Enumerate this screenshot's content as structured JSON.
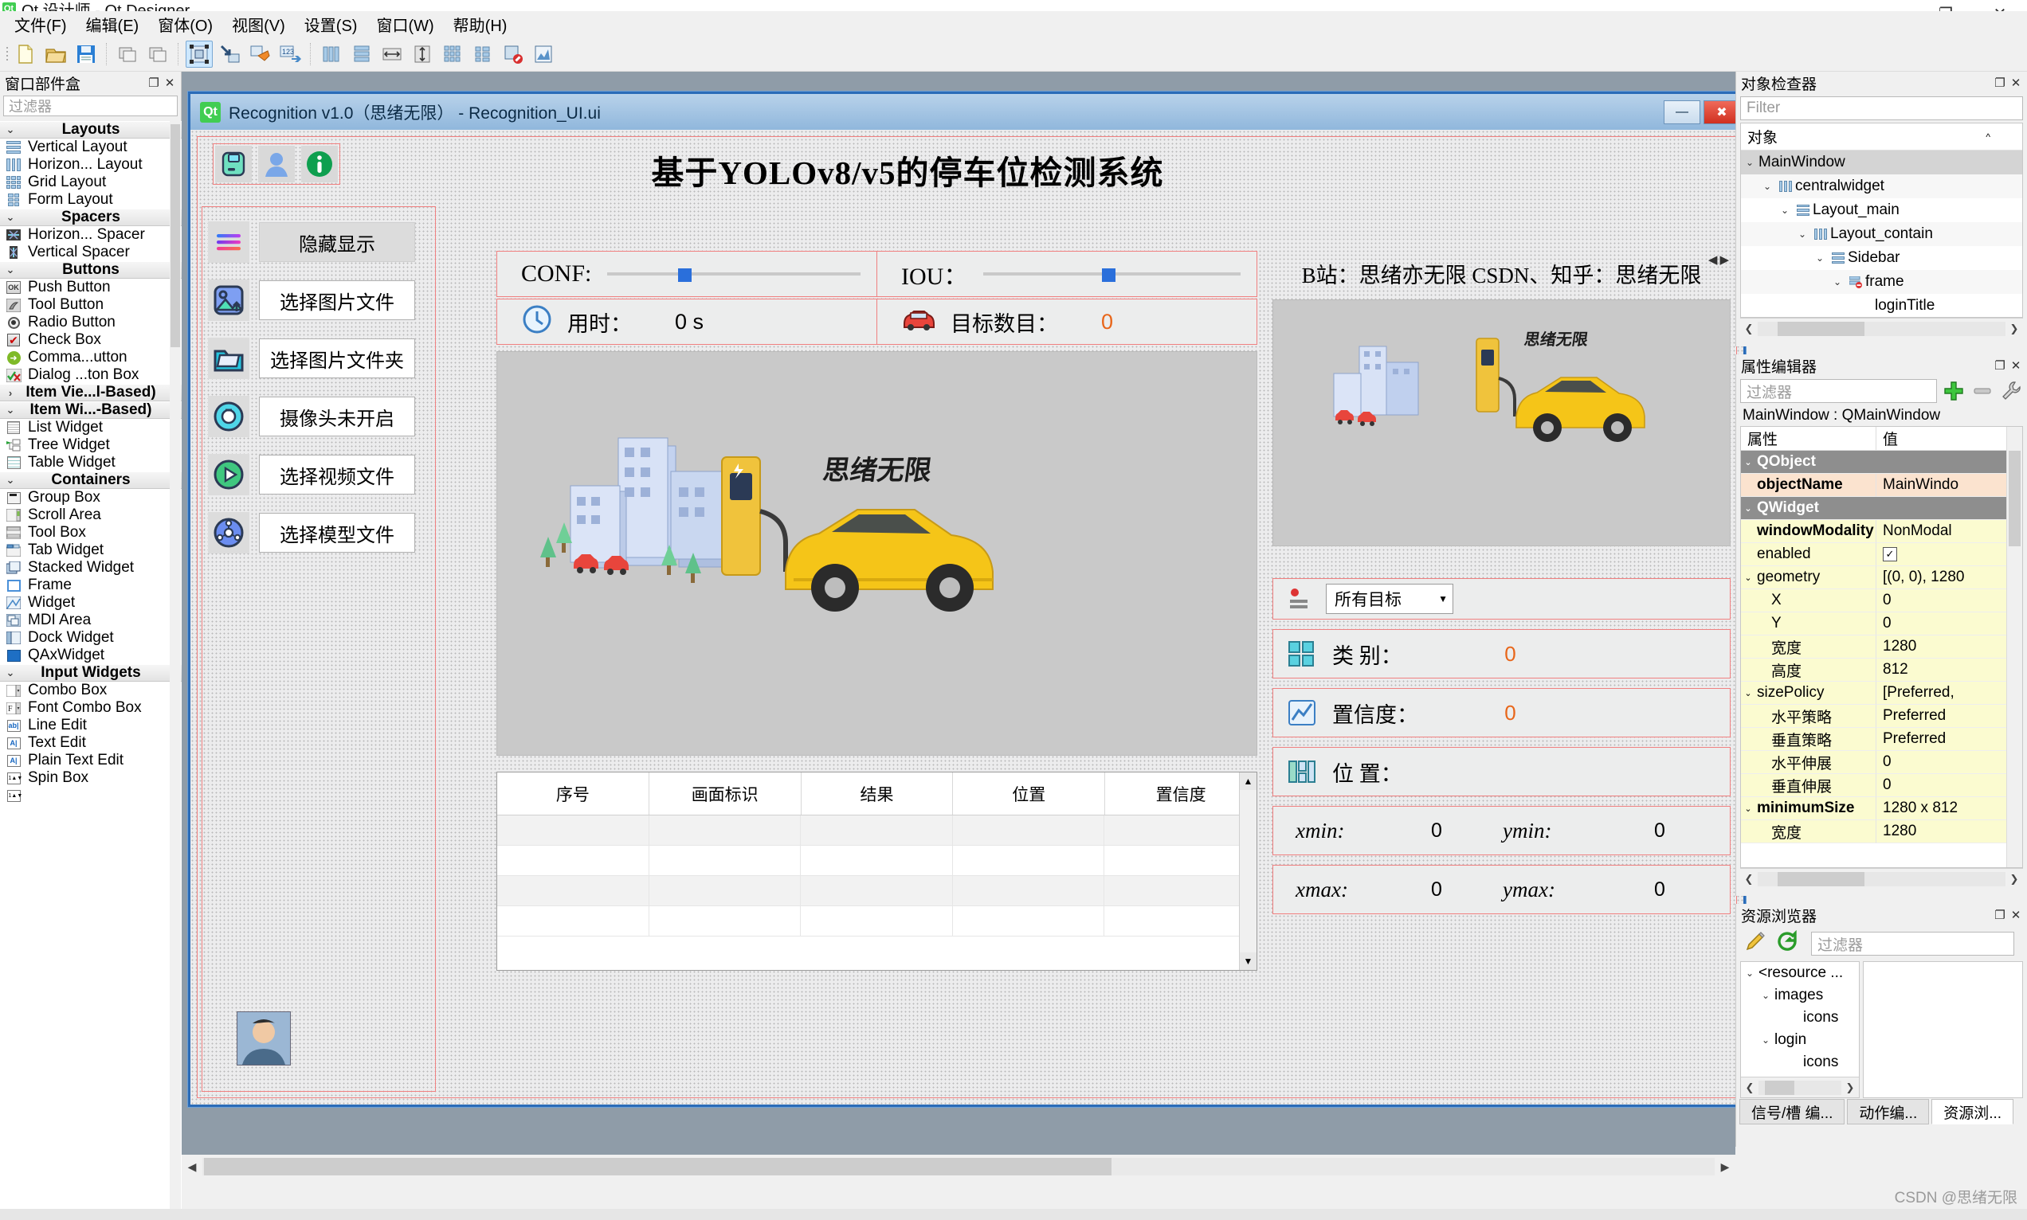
{
  "window": {
    "app_icon": "qt-icon",
    "title": "Qt 设计师 - Qt Designer",
    "minimize": "—",
    "maximize": "❐",
    "close": "✕"
  },
  "menubar": {
    "items": [
      {
        "label": "文件(F)"
      },
      {
        "label": "编辑(E)"
      },
      {
        "label": "窗体(O)"
      },
      {
        "label": "视图(V)"
      },
      {
        "label": "设置(S)"
      },
      {
        "label": "窗口(W)"
      },
      {
        "label": "帮助(H)"
      }
    ]
  },
  "widget_box": {
    "title": "窗口部件盒",
    "filter_placeholder": "过滤器",
    "float_icon": "restore-icon",
    "close_icon": "close-icon",
    "groups": [
      {
        "label": "Layouts",
        "expanded": true,
        "arrow": "⌄",
        "items": [
          {
            "label": "Vertical Layout",
            "icon": "vertical-layout-icon"
          },
          {
            "label": "Horizon... Layout",
            "icon": "horizontal-layout-icon"
          },
          {
            "label": "Grid Layout",
            "icon": "grid-layout-icon"
          },
          {
            "label": "Form Layout",
            "icon": "form-layout-icon"
          }
        ]
      },
      {
        "label": "Spacers",
        "expanded": true,
        "arrow": "⌄",
        "items": [
          {
            "label": "Horizon... Spacer",
            "icon": "horizontal-spacer-icon"
          },
          {
            "label": "Vertical Spacer",
            "icon": "vertical-spacer-icon"
          }
        ]
      },
      {
        "label": "Buttons",
        "expanded": true,
        "arrow": "⌄",
        "items": [
          {
            "label": "Push Button",
            "icon": "push-button-icon"
          },
          {
            "label": "Tool Button",
            "icon": "tool-button-icon"
          },
          {
            "label": "Radio Button",
            "icon": "radio-button-icon"
          },
          {
            "label": "Check Box",
            "icon": "check-box-icon"
          },
          {
            "label": "Comma...utton",
            "icon": "command-link-button-icon"
          },
          {
            "label": "Dialog ...ton Box",
            "icon": "dialog-button-box-icon"
          }
        ]
      },
      {
        "label": "Item Vie...l-Based)",
        "expanded": false,
        "arrow": "›",
        "items": []
      },
      {
        "label": "Item Wi...-Based)",
        "expanded": true,
        "arrow": "⌄",
        "items": [
          {
            "label": "List Widget",
            "icon": "list-widget-icon"
          },
          {
            "label": "Tree Widget",
            "icon": "tree-widget-icon"
          },
          {
            "label": "Table Widget",
            "icon": "table-widget-icon"
          }
        ]
      },
      {
        "label": "Containers",
        "expanded": true,
        "arrow": "⌄",
        "items": [
          {
            "label": "Group Box",
            "icon": "group-box-icon"
          },
          {
            "label": "Scroll Area",
            "icon": "scroll-area-icon"
          },
          {
            "label": "Tool Box",
            "icon": "tool-box-icon"
          },
          {
            "label": "Tab Widget",
            "icon": "tab-widget-icon"
          },
          {
            "label": "Stacked Widget",
            "icon": "stacked-widget-icon"
          },
          {
            "label": "Frame",
            "icon": "frame-icon"
          },
          {
            "label": "Widget",
            "icon": "widget-icon"
          },
          {
            "label": "MDI Area",
            "icon": "mdi-area-icon"
          },
          {
            "label": "Dock Widget",
            "icon": "dock-widget-icon"
          },
          {
            "label": "QAxWidget",
            "icon": "qax-widget-icon"
          }
        ]
      },
      {
        "label": "Input Widgets",
        "expanded": true,
        "arrow": "⌄",
        "items": [
          {
            "label": "Combo Box",
            "icon": "combo-box-icon"
          },
          {
            "label": "Font Combo Box",
            "icon": "font-combo-box-icon"
          },
          {
            "label": "Line Edit",
            "icon": "line-edit-icon"
          },
          {
            "label": "Text Edit",
            "icon": "text-edit-icon"
          },
          {
            "label": "Plain Text Edit",
            "icon": "plain-text-edit-icon"
          },
          {
            "label": "Spin Box",
            "icon": "spin-box-icon"
          }
        ]
      }
    ]
  },
  "form_window": {
    "titlebar": {
      "icon": "qt-icon",
      "title": "Recognition v1.0（思绪无限） - Recognition_UI.ui",
      "minimize": "—",
      "maximize": "❐",
      "close": "✖"
    },
    "app": {
      "title": "基于YOLOv8/v5的停车位检测系统",
      "top_icons": [
        {
          "name": "save-icon",
          "glyph": "save"
        },
        {
          "name": "user-icon",
          "glyph": "user"
        },
        {
          "name": "info-icon",
          "glyph": "info"
        }
      ],
      "sidebar": [
        {
          "icon": "menu-toggle-icon",
          "label": "隐藏显示",
          "style": "gray"
        },
        {
          "icon": "image-file-icon",
          "label": "选择图片文件",
          "style": "white"
        },
        {
          "icon": "folder-icon",
          "label": "选择图片文件夹",
          "style": "white"
        },
        {
          "icon": "camera-icon",
          "label": "摄像头未开启",
          "style": "white"
        },
        {
          "icon": "video-icon",
          "label": "选择视频文件",
          "style": "white"
        },
        {
          "icon": "model-icon",
          "label": "选择模型文件",
          "style": "white"
        }
      ],
      "avatar": "user-avatar",
      "conf_row": [
        {
          "name": "CONF:",
          "value_position": 28
        },
        {
          "name": "IOU：",
          "value_position": 46
        }
      ],
      "info_row": [
        {
          "icon": "clock-icon",
          "label": "用时：",
          "value": "0 s"
        },
        {
          "icon": "car-icon",
          "label": "目标数目：",
          "value": "0"
        }
      ],
      "preview_signature": "思绪无限",
      "result_table": {
        "columns": [
          "序号",
          "画面标识",
          "结果",
          "位置",
          "置信度"
        ],
        "rows": [
          [],
          [],
          []
        ]
      },
      "right_panel": {
        "banner": "B站：思绪亦无限 CSDN、知乎：思绪无限",
        "image_signature": "思绪无限",
        "target_select_label": "所有目标",
        "items": [
          {
            "icon": "category-icon",
            "label": "类 别：",
            "value": "0"
          },
          {
            "icon": "confidence-icon",
            "label": "置信度：",
            "value": "0"
          },
          {
            "icon": "position-icon",
            "label": "位 置：",
            "value": ""
          }
        ],
        "coords": [
          {
            "k1": "xmin:",
            "v1": "0",
            "k2": "ymin:",
            "v2": "0"
          },
          {
            "k1": "xmax:",
            "v1": "0",
            "k2": "ymax:",
            "v2": "0"
          }
        ]
      }
    }
  },
  "object_inspector": {
    "title": "对象检查器",
    "filter_placeholder": "Filter",
    "column_header": "对象",
    "float_icon": "restore-icon",
    "close_icon": "close-icon",
    "nodes": [
      {
        "label": "MainWindow",
        "depth": 0,
        "arrow": "⌄",
        "icon": "",
        "selected": true
      },
      {
        "label": "centralwidget",
        "depth": 1,
        "arrow": "⌄",
        "icon": "horizontal-layout-icon"
      },
      {
        "label": "Layout_main",
        "depth": 2,
        "arrow": "⌄",
        "icon": "vertical-layout-icon"
      },
      {
        "label": "Layout_contain",
        "depth": 3,
        "arrow": "⌄",
        "icon": "horizontal-layout-icon"
      },
      {
        "label": "Sidebar",
        "depth": 4,
        "arrow": "⌄",
        "icon": "vertical-layout-icon"
      },
      {
        "label": "frame",
        "depth": 5,
        "arrow": "⌄",
        "icon": "broken-layout-icon"
      },
      {
        "label": "loginTitle",
        "depth": 6,
        "arrow": "",
        "icon": ""
      }
    ]
  },
  "property_editor": {
    "title": "属性编辑器",
    "filter_placeholder": "过滤器",
    "add_icon": "plus-icon",
    "remove_icon": "minus-icon",
    "config_icon": "wrench-icon",
    "float_icon": "restore-icon",
    "close_icon": "close-icon",
    "class_line": "MainWindow : QMainWindow",
    "col_property": "属性",
    "col_value": "值",
    "rows": [
      {
        "name": "QObject",
        "value": "",
        "kind": "group",
        "arrow": "⌄",
        "depth": 0
      },
      {
        "name": "objectName",
        "value": "MainWindo",
        "kind": "orange",
        "bold": true,
        "depth": 1
      },
      {
        "name": "QWidget",
        "value": "",
        "kind": "group",
        "arrow": "⌄",
        "depth": 0
      },
      {
        "name": "windowModality",
        "value": "NonModal",
        "kind": "yellow",
        "bold": true,
        "depth": 1
      },
      {
        "name": "enabled",
        "value": "☑",
        "kind": "yellow",
        "depth": 1
      },
      {
        "name": "geometry",
        "value": "[(0, 0), 1280",
        "kind": "yellow",
        "bold": false,
        "arrow": "⌄",
        "depth": 0
      },
      {
        "name": "X",
        "value": "0",
        "kind": "yellow",
        "depth": 2
      },
      {
        "name": "Y",
        "value": "0",
        "kind": "yellow",
        "depth": 2
      },
      {
        "name": "宽度",
        "value": "1280",
        "kind": "yellow",
        "depth": 2
      },
      {
        "name": "高度",
        "value": "812",
        "kind": "yellow",
        "depth": 2
      },
      {
        "name": "sizePolicy",
        "value": "[Preferred, ",
        "kind": "yellow",
        "arrow": "⌄",
        "depth": 0
      },
      {
        "name": "水平策略",
        "value": "Preferred",
        "kind": "yellow",
        "depth": 2
      },
      {
        "name": "垂直策略",
        "value": "Preferred",
        "kind": "yellow",
        "depth": 2
      },
      {
        "name": "水平伸展",
        "value": "0",
        "kind": "yellow",
        "depth": 2
      },
      {
        "name": "垂直伸展",
        "value": "0",
        "kind": "yellow",
        "depth": 2
      },
      {
        "name": "minimumSize",
        "value": "1280 x 812",
        "kind": "yellow",
        "bold": true,
        "arrow": "⌄",
        "depth": 0
      },
      {
        "name": "宽度",
        "value": "1280",
        "kind": "yellow",
        "depth": 2
      }
    ]
  },
  "resource_browser": {
    "title": "资源浏览器",
    "edit_icon": "pencil-icon",
    "reload_icon": "refresh-icon",
    "filter_placeholder": "过滤器",
    "float_icon": "restore-icon",
    "close_icon": "close-icon",
    "tree": [
      {
        "label": "<resource ...",
        "depth": 0,
        "arrow": "⌄"
      },
      {
        "label": "images",
        "depth": 1,
        "arrow": "⌄"
      },
      {
        "label": "icons",
        "depth": 2,
        "arrow": ""
      },
      {
        "label": "login",
        "depth": 1,
        "arrow": "⌄"
      },
      {
        "label": "icons",
        "depth": 2,
        "arrow": ""
      }
    ]
  },
  "bottom_tabs": [
    {
      "label": "信号/槽 编...",
      "active": false
    },
    {
      "label": "动作编...",
      "active": false
    },
    {
      "label": "资源浏...",
      "active": true
    }
  ],
  "watermark": "CSDN @思绪无限",
  "colors": {
    "accent_blue": "#2a6fdb",
    "orange_value": "#e8661a",
    "form_border": "#2b6cb8",
    "red_guide": "#f08080",
    "green_icon": "#0e9f4f"
  }
}
